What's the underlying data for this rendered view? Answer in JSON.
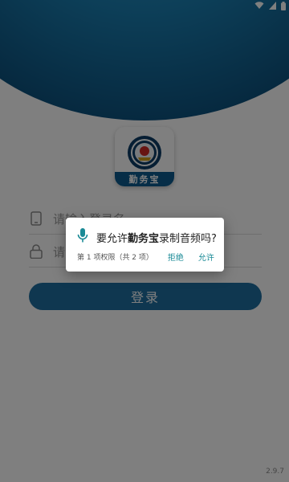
{
  "app": {
    "name": "勤务宝",
    "version": "2.9.7"
  },
  "login": {
    "username_placeholder": "请输入登录名",
    "password_placeholder": "请",
    "login_button": "登录"
  },
  "permission_dialog": {
    "prefix": "要允许",
    "app_name": "勤务宝",
    "suffix": "录制音频吗?",
    "counter": "第 1 项权限（共 2 项）",
    "deny_label": "拒绝",
    "allow_label": "允许"
  },
  "colors": {
    "primary": "#1f6fa0",
    "header_dark": "#0c4f7b",
    "dialog_accent": "#1a8a96",
    "mic_icon": "#1a8a96"
  },
  "icons": [
    "wifi-icon",
    "signal-icon",
    "battery-icon",
    "phone-icon",
    "lock-icon",
    "microphone-icon",
    "app-logo-emblem"
  ]
}
